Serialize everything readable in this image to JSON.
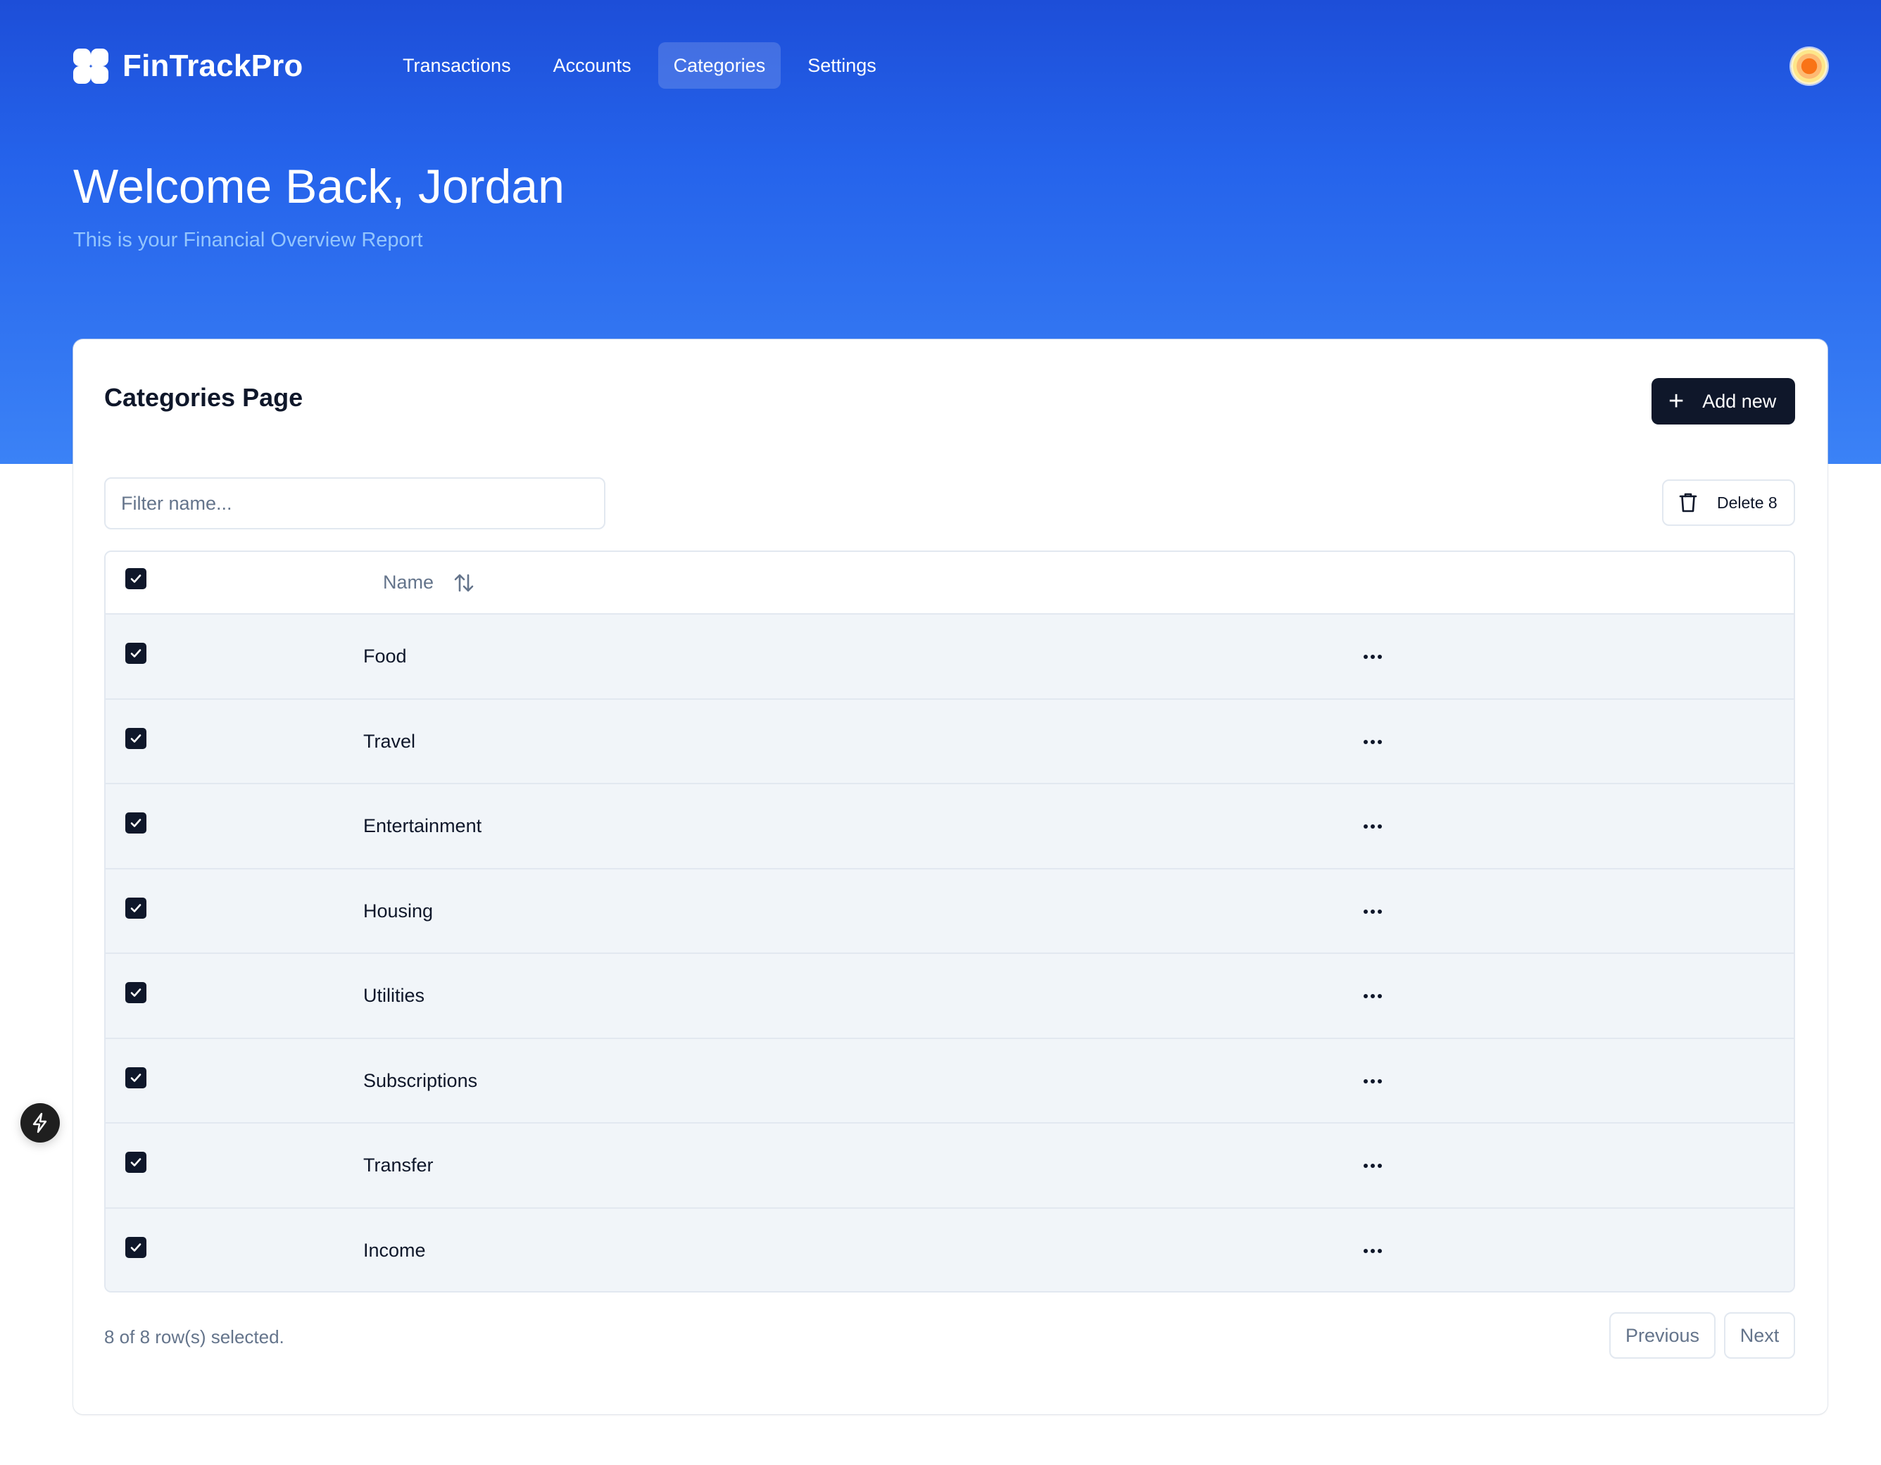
{
  "app": {
    "name": "FinTrackPro",
    "logo_icon": "clover-logo-icon"
  },
  "nav": {
    "items": [
      {
        "label": "Transactions",
        "active": false
      },
      {
        "label": "Accounts",
        "active": false
      },
      {
        "label": "Categories",
        "active": true
      },
      {
        "label": "Settings",
        "active": false
      }
    ]
  },
  "user": {
    "avatar_icon": "user-avatar"
  },
  "hero": {
    "title": "Welcome Back, Jordan",
    "subtitle": "This is your Financial Overview Report"
  },
  "card": {
    "title": "Categories Page",
    "add_label": "Add new",
    "filter_placeholder": "Filter name...",
    "filter_value": "",
    "delete_label": "Delete 8"
  },
  "table": {
    "columns": [
      {
        "label": "Name",
        "sortable": true
      }
    ],
    "header_checked": true,
    "rows": [
      {
        "name": "Food",
        "checked": true
      },
      {
        "name": "Travel",
        "checked": true
      },
      {
        "name": "Entertainment",
        "checked": true
      },
      {
        "name": "Housing",
        "checked": true
      },
      {
        "name": "Utilities",
        "checked": true
      },
      {
        "name": "Subscriptions",
        "checked": true
      },
      {
        "name": "Transfer",
        "checked": true
      },
      {
        "name": "Income",
        "checked": true
      }
    ]
  },
  "footer": {
    "selection_text": "8 of 8 row(s) selected.",
    "previous_label": "Previous",
    "next_label": "Next"
  },
  "colors": {
    "hero_top": "#1d4ed8",
    "hero_bottom": "#3b82f6",
    "primary_dark": "#0f172a",
    "row_background": "#f1f5f9",
    "muted_text": "#64748b"
  }
}
